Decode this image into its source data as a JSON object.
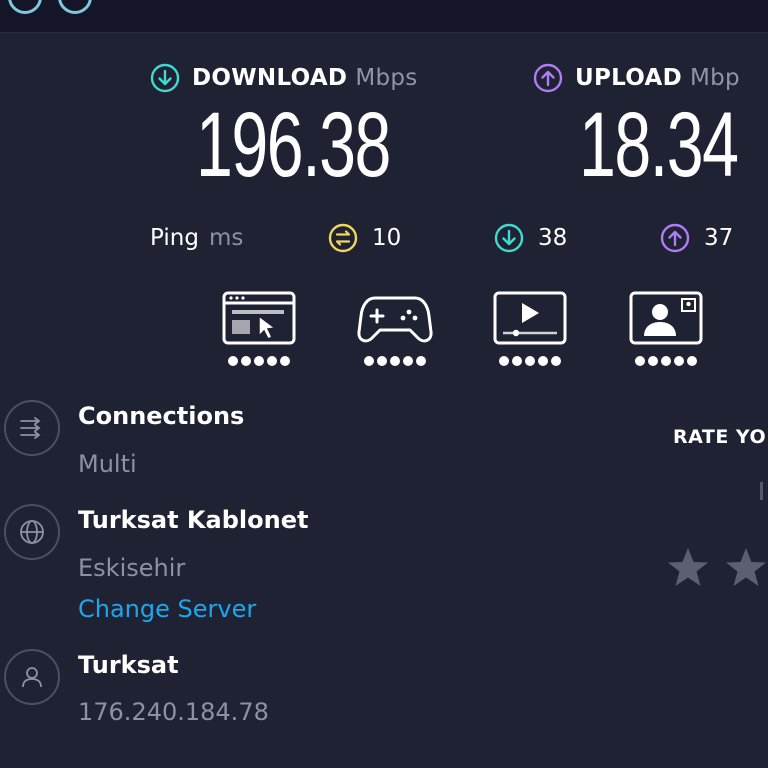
{
  "download": {
    "title": "DOWNLOAD",
    "unit": "Mbps",
    "value": "196.38"
  },
  "upload": {
    "title": "UPLOAD",
    "unit": "Mbp",
    "value": "18.34"
  },
  "ping": {
    "label": "Ping",
    "unit": "ms",
    "idle": "10",
    "download": "38",
    "upload": "37"
  },
  "connections": {
    "title": "Connections",
    "value": "Multi"
  },
  "server": {
    "name": "Turksat Kablonet",
    "location": "Eskisehir",
    "change_label": "Change Server"
  },
  "provider": {
    "name": "Turksat",
    "ip": "176.240.184.78"
  },
  "rating": {
    "label": "RATE YO"
  },
  "colors": {
    "background": "#1f2233",
    "download_accent": "#3fd9d0",
    "upload_accent": "#b07cf5",
    "idle_accent": "#f0d65a",
    "link": "#1ca7ec"
  },
  "icons": {
    "download": "arrow-down-circle-icon",
    "upload": "arrow-up-circle-icon",
    "idle": "idle-latency-icon",
    "web": "web-browsing-icon",
    "gaming": "gamepad-icon",
    "streaming": "video-streaming-icon",
    "video_call": "video-call-icon",
    "connections": "connections-icon",
    "globe": "globe-icon",
    "user": "user-icon",
    "star": "star-icon"
  }
}
